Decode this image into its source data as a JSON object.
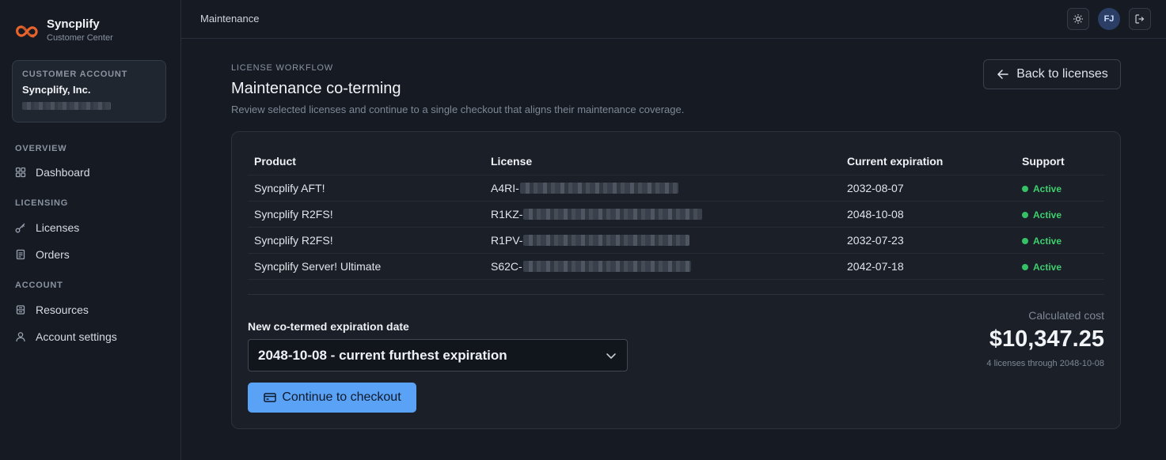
{
  "brand": {
    "name": "Syncplify",
    "subtitle": "Customer Center",
    "logo_icon": "infinity-logo",
    "accent": "#e8642c"
  },
  "account_card": {
    "label": "CUSTOMER ACCOUNT",
    "name": "Syncplify, Inc."
  },
  "nav": {
    "sections": [
      {
        "title": "OVERVIEW",
        "items": [
          {
            "label": "Dashboard",
            "icon": "grid-icon"
          }
        ]
      },
      {
        "title": "LICENSING",
        "items": [
          {
            "label": "Licenses",
            "icon": "key-icon"
          },
          {
            "label": "Orders",
            "icon": "receipt-icon"
          }
        ]
      },
      {
        "title": "ACCOUNT",
        "items": [
          {
            "label": "Resources",
            "icon": "database-icon"
          },
          {
            "label": "Account settings",
            "icon": "user-icon"
          }
        ]
      }
    ]
  },
  "topbar": {
    "breadcrumb": "Maintenance",
    "avatar_initials": "FJ"
  },
  "page": {
    "eyebrow": "LICENSE WORKFLOW",
    "title": "Maintenance co-terming",
    "description": "Review selected licenses and continue to a single checkout that aligns their maintenance coverage.",
    "back_button": "Back to licenses"
  },
  "table": {
    "headers": [
      "Product",
      "License",
      "Current expiration",
      "Support"
    ],
    "rows": [
      {
        "product": "Syncplify AFT!",
        "license_prefix": "A4RI-",
        "expiration": "2032-08-07",
        "support": "Active"
      },
      {
        "product": "Syncplify R2FS!",
        "license_prefix": "R1KZ-",
        "expiration": "2048-10-08",
        "support": "Active"
      },
      {
        "product": "Syncplify R2FS!",
        "license_prefix": "R1PV-",
        "expiration": "2032-07-23",
        "support": "Active"
      },
      {
        "product": "Syncplify Server! Ultimate",
        "license_prefix": "S62C-",
        "expiration": "2042-07-18",
        "support": "Active"
      }
    ],
    "status_color": "#35c267"
  },
  "coterm": {
    "field_label": "New co-termed expiration date",
    "selected_option": "2048-10-08 - current furthest expiration",
    "checkout_button": "Continue to checkout",
    "cost_label": "Calculated cost",
    "cost_value": "$10,347.25",
    "cost_sub": "4 licenses through 2048-10-08",
    "button_color": "#5aa2f5"
  }
}
